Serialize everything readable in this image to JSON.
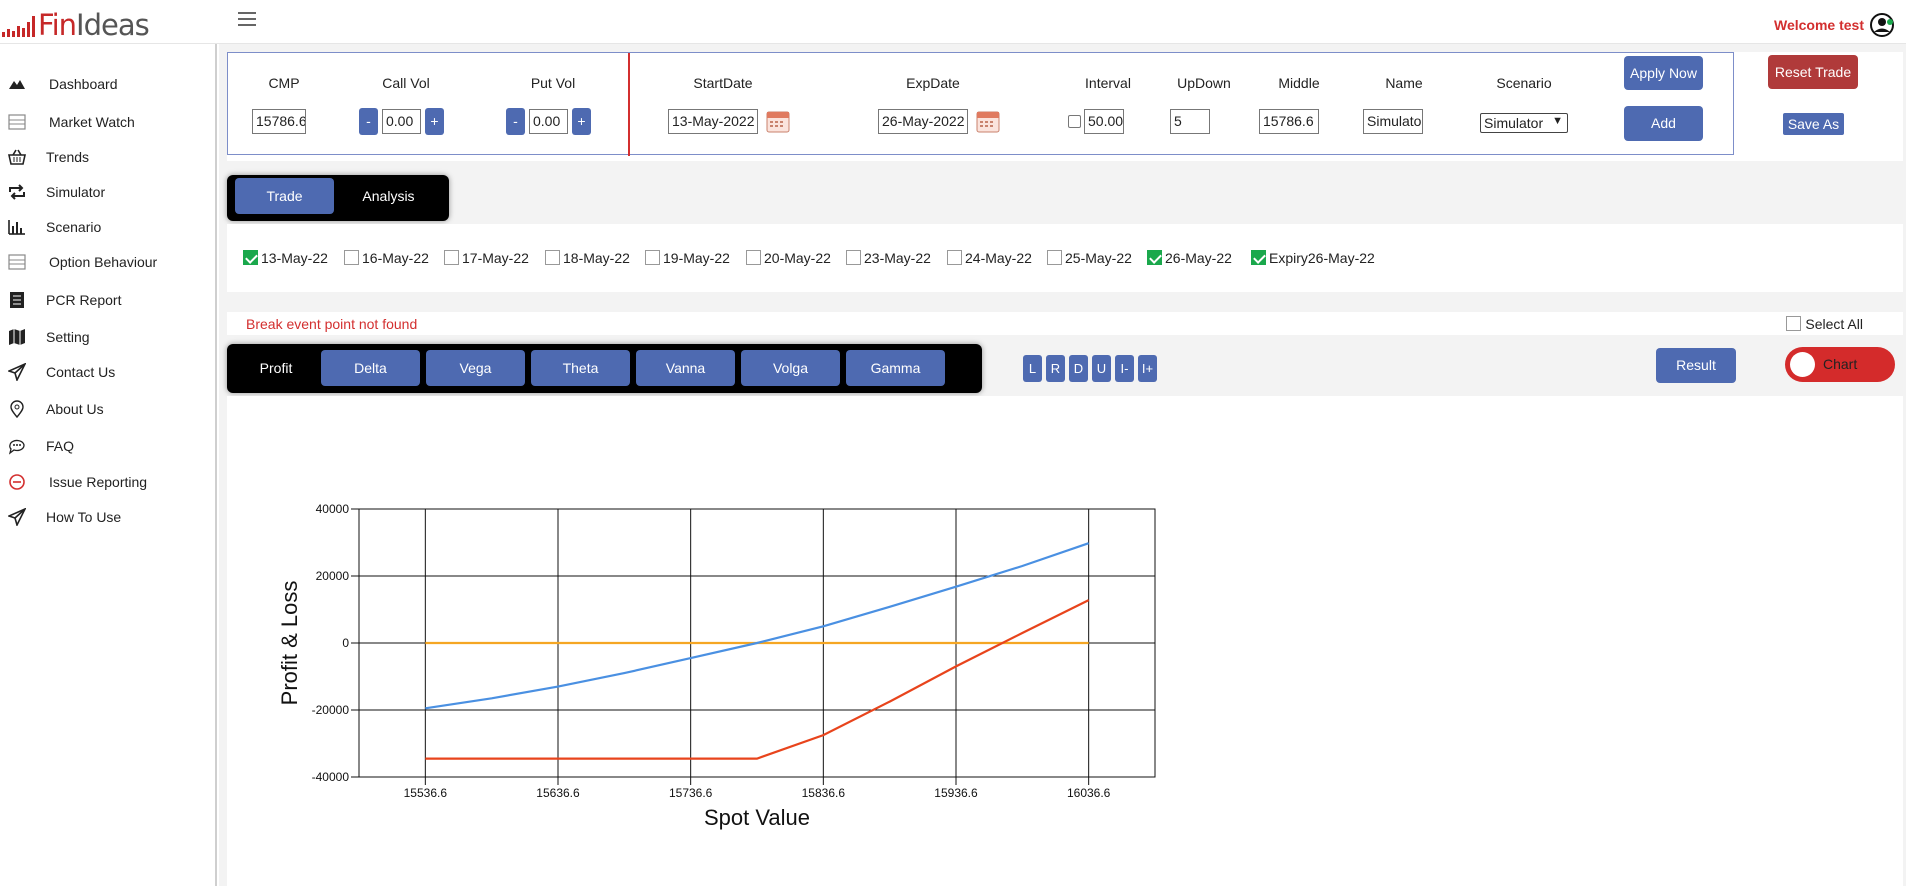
{
  "header": {
    "logo_fin": "Fin",
    "logo_ideas": "Ideas",
    "welcome": "Welcome test",
    "brand_color": "#c62828"
  },
  "sidebar": {
    "items": [
      {
        "label": "Dashboard",
        "icon": "mountain-icon"
      },
      {
        "label": "Market Watch",
        "icon": "table-icon"
      },
      {
        "label": "Trends",
        "icon": "basket-icon"
      },
      {
        "label": "Simulator",
        "icon": "repeat-icon"
      },
      {
        "label": "Scenario",
        "icon": "bar-chart-icon"
      },
      {
        "label": "Option Behaviour",
        "icon": "table-icon"
      },
      {
        "label": "PCR Report",
        "icon": "report-icon"
      },
      {
        "label": "Setting",
        "icon": "map-icon"
      },
      {
        "label": "Contact Us",
        "icon": "paper-plane-icon"
      },
      {
        "label": "About Us",
        "icon": "location-pin-icon"
      },
      {
        "label": "FAQ",
        "icon": "chat-icon"
      },
      {
        "label": "Issue Reporting",
        "icon": "minus-circle-icon"
      },
      {
        "label": "How To Use",
        "icon": "paper-plane-icon"
      }
    ]
  },
  "params": {
    "cmp_label": "CMP",
    "cmp_value": "15786.6",
    "callvol_label": "Call Vol",
    "callvol_value": "0.00",
    "putvol_label": "Put Vol",
    "putvol_value": "0.00",
    "minus": "-",
    "plus": "+",
    "startdate_label": "StartDate",
    "startdate_value": "13-May-2022",
    "expdate_label": "ExpDate",
    "expdate_value": "26-May-2022",
    "interval_label": "Interval",
    "interval_value": "50.00",
    "updown_label": "UpDown",
    "updown_value": "5",
    "middle_label": "Middle",
    "middle_value": "15786.6",
    "name_label": "Name",
    "name_value": "Simulator",
    "scenario_label": "Scenario",
    "scenario_value": "Simulator",
    "apply_now": "Apply Now",
    "add": "Add",
    "reset_trade": "Reset Trade",
    "save_as": "Save As"
  },
  "top_tabs": {
    "trade": "Trade",
    "analysis": "Analysis"
  },
  "dates": [
    {
      "label": "13-May-22",
      "checked": true
    },
    {
      "label": "16-May-22",
      "checked": false
    },
    {
      "label": "17-May-22",
      "checked": false
    },
    {
      "label": "18-May-22",
      "checked": false
    },
    {
      "label": "19-May-22",
      "checked": false
    },
    {
      "label": "20-May-22",
      "checked": false
    },
    {
      "label": "23-May-22",
      "checked": false
    },
    {
      "label": "24-May-22",
      "checked": false
    },
    {
      "label": "25-May-22",
      "checked": false
    },
    {
      "label": "26-May-22",
      "checked": true
    },
    {
      "label": "Expiry26-May-22",
      "checked": true
    }
  ],
  "status": {
    "break_even": "Break event point not found",
    "select_all": "Select All"
  },
  "greek_tabs": [
    "Profit",
    "Delta",
    "Vega",
    "Theta",
    "Vanna",
    "Volga",
    "Gamma"
  ],
  "nav_buttons": [
    "L",
    "R",
    "D",
    "U",
    "I-",
    "I+"
  ],
  "result_button": "Result",
  "chart_toggle": "Chart",
  "chart_data": {
    "type": "line",
    "xlabel": "Spot Value",
    "ylabel": "Profit & Loss",
    "xlim": [
      15486.6,
      16086.6
    ],
    "ylim": [
      -40000,
      40000
    ],
    "x_ticks": [
      "15536.6",
      "15636.6",
      "15736.6",
      "15836.6",
      "15936.6",
      "16036.6"
    ],
    "y_ticks": [
      "40000",
      "20000",
      "0",
      "-20000",
      "-40000"
    ],
    "grid": true,
    "series": [
      {
        "color": "#4a90e2",
        "x": [
          15536.6,
          15586.6,
          15636.6,
          15686.6,
          15736.6,
          15786.6,
          15836.6,
          15886.6,
          15936.6,
          15986.6,
          16036.6
        ],
        "y": [
          -19500,
          -16500,
          -13000,
          -9000,
          -4500,
          0,
          5000,
          10800,
          16800,
          23000,
          29800
        ]
      },
      {
        "color": "#e8441c",
        "x": [
          15536.6,
          15586.6,
          15636.6,
          15686.6,
          15736.6,
          15786.6,
          15836.6,
          15886.6,
          15936.6,
          15986.6,
          16036.6
        ],
        "y": [
          -34500,
          -34500,
          -34500,
          -34500,
          -34500,
          -34500,
          -27500,
          -17500,
          -7000,
          3000,
          12800
        ]
      },
      {
        "color": "#f5a623",
        "x": [
          15536.6,
          16036.6
        ],
        "y": [
          0,
          0
        ]
      }
    ]
  }
}
